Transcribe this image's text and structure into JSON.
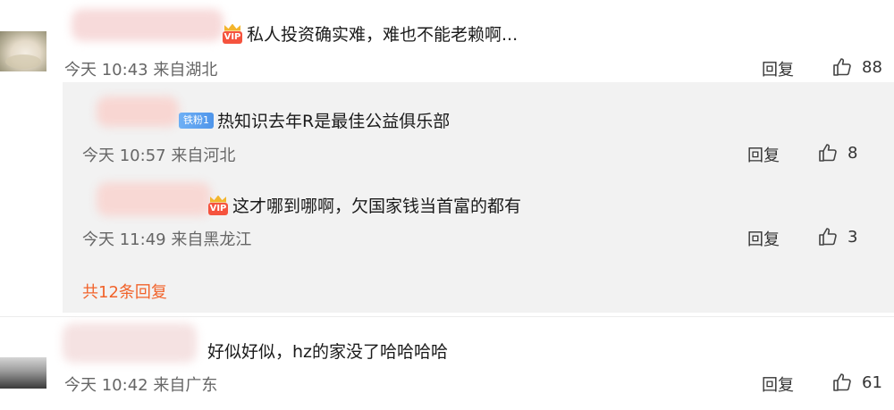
{
  "comments": [
    {
      "text": "私人投资确实难，难也不能老赖啊...",
      "time": "今天 10:43",
      "location": "来自湖北",
      "reply_label": "回复",
      "likes": "88",
      "badge": "VIP"
    },
    {
      "text": "好似好似，hz的家没了哈哈哈哈",
      "time": "今天 10:42",
      "location": "来自广东",
      "reply_label": "回复",
      "likes": "61"
    }
  ],
  "replies": [
    {
      "badge": "铁粉1",
      "text": "热知识去年R是最佳公益俱乐部",
      "time": "今天 10:57",
      "location": "来自河北",
      "reply_label": "回复",
      "likes": "8"
    },
    {
      "badge": "VIP",
      "text": "这才哪到哪啊，欠国家钱当首富的都有",
      "time": "今天 11:49",
      "location": "来自黑龙江",
      "reply_label": "回复",
      "likes": "3"
    }
  ],
  "more_replies_label": "共12条回复",
  "colors": {
    "accent": "#f1632b",
    "vip_red": "#f5533e",
    "vip_crown": "#f3b52d",
    "fan_blue": "#4f95ea",
    "reply_bg": "#f2f2f2"
  },
  "icons": [
    "thumbs-up-icon",
    "vip-crown-icon",
    "fan-badge-icon"
  ]
}
